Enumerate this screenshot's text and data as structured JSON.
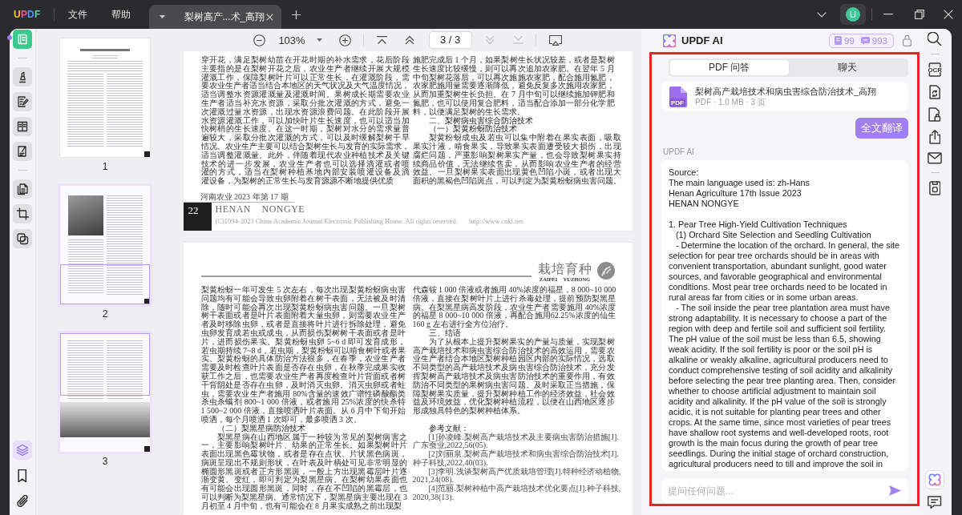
{
  "title_bar": {
    "logo": "UPDF",
    "menus": [
      "文件",
      "帮助"
    ],
    "tabs": [
      {
        "title": "梨树高产...术_高翔",
        "selected": true
      }
    ],
    "user_initial": "U"
  },
  "left_toolbar": {
    "top_tools": [
      {
        "selected": true
      },
      {
        "selected": false
      },
      {
        "selected": false
      },
      {
        "selected": false
      },
      {
        "selected": false
      },
      {
        "selected": false
      },
      {
        "selected": false
      },
      {
        "selected": false
      }
    ],
    "bottom_tools": [
      {
        "selected": true
      },
      {
        "selected": false
      },
      {
        "selected": false
      }
    ]
  },
  "thumbnails": [
    {
      "label": "1",
      "kind": "title-page",
      "top_in_view": false,
      "bottom_in_view": false
    },
    {
      "label": "2",
      "kind": "photo-top",
      "top_in_view": false,
      "bottom_in_view": true
    },
    {
      "label": "3",
      "kind": "photo-bottom",
      "top_in_view": true,
      "bottom_in_view": false
    }
  ],
  "doc_toolbar": {
    "zoom": "103%",
    "page_indicator": "3 / 3",
    "nav": [
      {
        "disabled": false
      },
      {
        "disabled": false
      },
      {
        "disabled": true
      },
      {
        "disabled": true
      }
    ]
  },
  "pages": [
    {
      "columns": [
        [
          {
            "kind": "body",
            "continued": true,
            "lines": [
              "穿开花，满足梨树幼苗在开花时期的补水需求，花后阶段",
              "主要指的是在梨树开花之后，农业生产者继续开展大规模",
              "灌溉工作，保障梨树叶片可以正常生长，在灌溉阶段，需",
              "要农业生产者适当结合本地区的天气状况及大气温度情况，",
              "适当调整水资源灌溉量及灌溉时间。果树成长期需要农业",
              "生产者适当补充水资源，采取分批次灌溉的方式，避免一",
              "次灌溉过量水资源，出现水资源浪费问题。在此阶段开展",
              "水资源灌溉工作，可以加快叶片生长速度，也可以适当加",
              "快树梢的生长速度。在这一时期，梨树对水分的需求量普",
              "遍较大，采取分批次灌溉的方式，可以及时缓解梨树干旱",
              "情况。农业生产主要可以结合梨树生长与发育的实际需求，",
              "适当调整灌溉量。此外，伴随着现代农业种植技术及关键",
              "技术的进一步发展，农业生产者也可以选择滴灌或者喷",
              "灌的方式，适当在梨树种植基地内部安装喷灌设备及滴",
              "灌设备，为梨树的正常生长与发育源源不断地提供优质"
            ]
          }
        ],
        [
          {
            "kind": "body",
            "continued": true,
            "lines": [
              "施肥完成后 1 个月，如果梨树生长状况较差，或者是梨树",
              "生长速度比较缓慢，则可以再次追加农家肥。在翌年 5 月",
              "中旬梨树花落后，可以再次施施农家肥，配合施用氮肥，",
              "农家肥施用量需要逐渐降低，避免反复多次施用农家肥，",
              "从而加重梨树生长负担。在 7 月中旬可以继续施加钾肥和",
              "氮肥，也可以使用复合肥料，适当配合添加一部分化学肥",
              "料，以便满足梨树的生长需求。"
            ]
          },
          {
            "kind": "heading",
            "continued": false,
            "lines": [
              "二、梨树病虫害综合防治技术"
            ]
          },
          {
            "kind": "heading",
            "continued": false,
            "lines": [
              "（一）梨黄粉蚜防治技术"
            ]
          },
          {
            "kind": "body",
            "continued": false,
            "lines": [
              "梨黄粉蚜成虫及若虫可以集中附着在果实表面，吸取",
              "果实汁液，啃食果实，导致果实表面遭受较大损伤，出现",
              "腐烂问题，严重影响梨树果实产量，也会导致梨树果实持",
              "续商品价值，无法继续售卖，从而影响农业生产者的经营",
              "效益。一旦梨树果实表面出现黄色凹陷小斑，或者出现大",
              "面积的黑褐色凹陷斑点，可以判定为梨黄粉蚜病虫害问题。"
            ]
          }
        ]
      ],
      "footer": {
        "journal": "河南农业 2023 年第 17 期",
        "page_number": "22",
        "journal_pinyin": "HENAN NONGYE",
        "copyright": "(C)1994-2023 China Academic Journal Electronic Publishing House. All rights reserved.",
        "url": "http://www.cnki.net"
      }
    },
    {
      "header": {
        "section": "栽培育种",
        "section_pinyin": "ZAIPEI YUZHONG"
      },
      "columns": [
        [
          {
            "kind": "body",
            "continued": true,
            "lines": [
              "梨黄粉蚜一年可发生 5 次左右，每次出现梨黄粉蚜病虫害",
              "问题均有可能会导致虫卵附着在树干表面，无法被及时清",
              "除，随时可能会再次出现梨黄粉蚜病虫害问题。一旦梨树",
              "树干表面或者是叶片表面附着大量虫卵，则需要农业生产",
              "者及时移除虫卵，或者是直接将叶片进行拆除处理，避免",
              "虫卵发育成若虫或成虫，从而损伤梨树树干表面或者是叶",
              "片，进而损伤果实。梨黄粉蚜虫卵 5~6 d 即可发育成形，",
              "若虫期持续 7~8 d，若虫期，梨黄粉蚜可以啃食树叶或者果",
              "实。梨黄粉蚜的具体防治方法很多，在春季，农业生产者",
              "需要及时检查叶片表面是否存在虫卵，在秋季完成果实收",
              "获工作之后，也需要农业生产者再度检查叶片背面或者树",
              "干背阴处是否存在虫卵，及时消灭虫卵。消灭虫卵或者蛀",
              "虫，需要农业生产者施用 80%含量的速效广谱性磷酸酯类",
              "杀虫杀螨剂 800~1 000 倍液，或者施用 25%浓度的快杀特",
              "1 500~2 000 倍液，直接喷洒叶片表面。从 6 月中下旬开始",
              "喷洒，每个月喷洒 1 次即可，最多喷洒 3 次。"
            ]
          },
          {
            "kind": "heading",
            "continued": false,
            "lines": [
              "（二）梨黑星病防治技术"
            ]
          },
          {
            "kind": "body",
            "continued": false,
            "lines": [
              "梨黑星病在山西地区属于一种较为常见的梨树病害之",
              "一，主要影响梨树叶片、幼果的正常生长。如果梨树叶片",
              "表面出现黑色霉状物，或者是存在点状、片状黑色病斑，",
              "病斑呈现出不规则形状，在叶表及叶柄处可见非常明显的",
              "椭圆形黑斑或者正方形黑斑，一般上方出现黑霉层叶片逐",
              "渐变黄、变红，即可判定为梨黑星病。在梨树幼果表面也",
              "有可能会出现圆形黑斑，同时，存在不凹陷的黑霉层，也",
              "可以判断为梨黑星病。通常情况下，梨黑星病主要出现在 3",
              "月初至 4 月中旬，也有可能会在 8 月果实成熟之前出现梨"
            ]
          }
        ],
        [
          {
            "kind": "body",
            "continued": true,
            "lines": [
              "代森铵 1 000 倍液或者施用 40%浓度的福星，8 000~10 000",
              "倍液，直接在梨树叶片上进行杀毒处理，提前预防梨黑星",
              "病。在梨黑星病高发阶段，农业生产者需要施用 40%浓度",
              "的福星 8 000~10 000 倍液，再配合施用62.25%浓度的仙生",
              "160 g 左右进行全方位治疗。"
            ]
          },
          {
            "kind": "heading",
            "continued": false,
            "lines": [
              "三、结语"
            ]
          },
          {
            "kind": "body",
            "continued": false,
            "lines": [
              "为了从根本上提升梨树果实的产量与质量，实现梨树",
              "高产栽培技术和病虫害综合防治技术的高效运用，需要农",
              "业生产者结合本地区梨树种植园区内部的实际情况，选取",
              "不同类型的高产栽培技术及病虫害综合防治技术，充分发",
              "挥梨树高产栽培技术及病虫害防治技术的重要作用，有效",
              "防治不同类型的果树病虫害问题。及时采取正当措施，保",
              "障梨树果实质量，提升梨树种植工作的经济效益，社会效",
              "益及环境效益，优化梨树种植流程，以便在山西地区逐步",
              "形成独具特色的梨树种植体系。"
            ]
          },
          {
            "kind": "references-title",
            "continued": false,
            "lines": [
              "参考文献："
            ]
          },
          {
            "kind": "reference",
            "continued": false,
            "lines": [
              "[1]孙凌峰.梨树高产栽培技术及主要病虫害防治措施[J].",
              "广东蚕业,2022,56(05)."
            ]
          },
          {
            "kind": "reference",
            "continued": false,
            "lines": [
              "[2]刘丽泉.梨树高产栽培技术和病虫害综合防治技术[J].",
              "种子科技,2022,40(03)."
            ]
          },
          {
            "kind": "reference",
            "continued": false,
            "lines": [
              "[3]李明.浅谈梨树高产优质栽培管理[J].特种经济动植物,",
              "2021,24(08)."
            ]
          },
          {
            "kind": "reference",
            "continued": false,
            "lines": [
              "[4]范丽.梨树种植中高产栽培技术优化要点[J].种子科技,",
              "2020,38(13)."
            ]
          }
        ]
      ]
    }
  ],
  "ai_panel": {
    "title": "UPDF AI",
    "credits": [
      "99",
      "993"
    ],
    "tabs": [
      {
        "label": "PDF 问答",
        "selected": true
      },
      {
        "label": "聊天",
        "selected": false
      }
    ],
    "file": {
      "icon_label": "PDF",
      "name": "梨树高产栽培技术和病虫害综合防治技术_高翔",
      "info": "PDF · 1.0 MB · 3 页"
    },
    "translate_button": "全文翻译",
    "sender": "UPDF AI",
    "response": "Source:\nThe main language used is: zh-Hans\nHenan Agriculture 17th Issue 2023\nHENAN NONGYE\n\n1. Pear Tree High-Yield Cultivation Techniques\n   (1) Orchard Site Selection and Seedling Cultivation\n   - Determine the location of the orchard. In general, the site selection for pear tree orchards should be in areas with convenient transportation, abundant sunlight, good water sources, and favorable geographical and environmental conditions. Most pear tree orchards need to be located in rural areas far from cities or in some urban areas.\n   - The soil inside the pear tree plantation area must have strong adaptability. It is necessary to choose a part of the region with deep and fertile soil and sufficient soil fertility. The pH value of the soil must be less than 6.5, showing weak acidity. If the soil fertility is poor or the soil pH is alkaline or weakly alkaline, agricultural producers need to conduct comprehensive testing of soil acidity and alkalinity before selecting the pear tree planting area. Then, consider whether to choose artificial adjustment to maintain soil acidity and alkalinity. If the pH value of the soil is strongly acidic, it is not suitable for planting pear trees and other crops. At the same time, since most varieties of pear trees have shallow root systems and well-developed roots, root growth is the main focus during the growth of pear tree seedlings. During the initial stage of orchard construction, agricultural producers need to till and improve the soil in",
    "input": {
      "placeholder": "提问任何问题..."
    }
  },
  "right_toolbar": {
    "top_tools": [
      {
        "selected": false
      },
      {
        "selected": false,
        "label": "OCR"
      },
      {
        "selected": false
      },
      {
        "selected": false
      },
      {
        "selected": false
      },
      {
        "selected": false
      },
      {
        "selected": false
      }
    ],
    "bottom_tools": [
      {
        "selected": true
      },
      {
        "selected": false
      }
    ]
  }
}
